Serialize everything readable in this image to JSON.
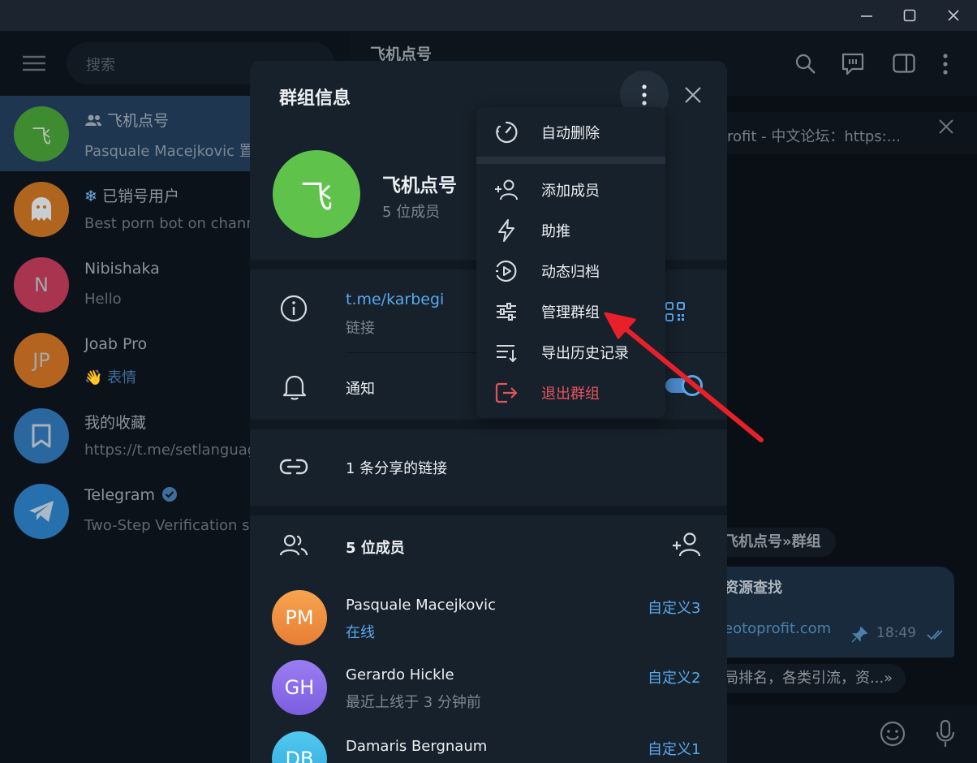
{
  "sidebar": {
    "search_placeholder": "搜索",
    "chats": [
      {
        "name": "飞机点号",
        "message": "Pasquale Macejkovic 置",
        "avatar": "飞",
        "color": "#3a8a2e"
      },
      {
        "name": "已销号用户",
        "message": "Best porn bot on chann",
        "avatar": "ghost",
        "color": "#b86a23"
      },
      {
        "name": "Nibishaka",
        "message": "Hello",
        "avatar": "N",
        "color": "#b63b56"
      },
      {
        "name": "Joab Pro",
        "message_emoji": "👋",
        "message": "表情",
        "avatar": "JP",
        "color": "#b8692a"
      },
      {
        "name": "我的收藏",
        "message": "https://t.me/setlanguag",
        "avatar": "bookmark",
        "color": "#2b6aa6"
      },
      {
        "name": "Telegram",
        "message": "Two-Step Verification s",
        "avatar": "telegram",
        "color": "#2d79b6"
      }
    ]
  },
  "chat": {
    "title": "飞机点号",
    "pinned_text": "rofit - 中文论坛：https:...",
    "service_message": "飞机点号»群组",
    "bubble_title": "资源查找",
    "bubble_link": "eotoprofit.com",
    "bubble_time": "18:49",
    "bottom_text": "局排名，各类引流，资...»"
  },
  "dialog": {
    "title": "群组信息",
    "group_name": "飞机点号",
    "member_count": "5 位成员",
    "avatar_letter": "飞",
    "link": "t.me/karbegi",
    "link_label": "链接",
    "notifications_label": "通知",
    "notifications_on": true,
    "shared_links": "1 条分享的链接",
    "members_header": "5 位成员",
    "members": [
      {
        "initials": "PM",
        "name": "Pasquale Macejkovic",
        "status": "在线",
        "status_online": true,
        "tag": "自定义3",
        "color_top": "#f7a44e",
        "color_bottom": "#e77e35"
      },
      {
        "initials": "GH",
        "name": "Gerardo Hickle",
        "status": "最近上线于 3 分钟前",
        "status_online": false,
        "tag": "自定义2",
        "color_top": "#9b7df2",
        "color_bottom": "#7b5ee0"
      },
      {
        "initials": "DB",
        "name": "Damaris Bergnaum",
        "status": "",
        "status_online": false,
        "tag": "自定义1",
        "color_top": "#52c9ef",
        "color_bottom": "#2ea9e0"
      }
    ]
  },
  "menu": {
    "items": [
      {
        "label": "自动删除",
        "icon": "timer-icon"
      },
      {
        "label": "添加成员",
        "icon": "add-user-icon"
      },
      {
        "label": "助推",
        "icon": "boost-icon"
      },
      {
        "label": "动态归档",
        "icon": "stories-archive-icon"
      },
      {
        "label": "管理群组",
        "icon": "manage-icon"
      },
      {
        "label": "导出历史记录",
        "icon": "export-icon"
      },
      {
        "label": "退出群组",
        "icon": "leave-icon",
        "danger": true
      }
    ]
  },
  "colors": {
    "accent": "#5aa8ec",
    "danger": "#e4545c",
    "arrow": "#e8202a",
    "group_avatar": "#5ec24b"
  }
}
